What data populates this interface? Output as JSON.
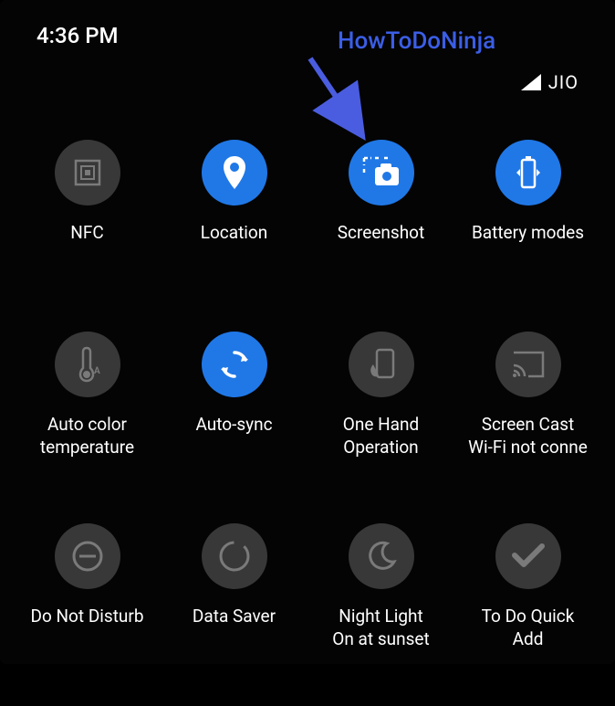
{
  "status": {
    "time": "4:36 PM",
    "carrier": "JIO"
  },
  "watermark": "HowToDoNinja",
  "tiles": {
    "row1": [
      {
        "label": "NFC",
        "active": false
      },
      {
        "label": "Location",
        "active": true
      },
      {
        "label": "Screenshot",
        "active": true
      },
      {
        "label": "Battery modes",
        "active": true
      }
    ],
    "row2": [
      {
        "label": "Auto color\ntemperature",
        "active": false
      },
      {
        "label": "Auto-sync",
        "active": true
      },
      {
        "label": "One Hand\nOperation",
        "active": false
      },
      {
        "label": "Screen Cast\nWi-Fi not conne",
        "active": false
      }
    ],
    "row3": [
      {
        "label": "Do Not Disturb",
        "active": false
      },
      {
        "label": "Data Saver",
        "active": false
      },
      {
        "label": "Night Light\nOn at sunset",
        "active": false
      },
      {
        "label": "To Do Quick\nAdd",
        "active": false
      }
    ]
  }
}
